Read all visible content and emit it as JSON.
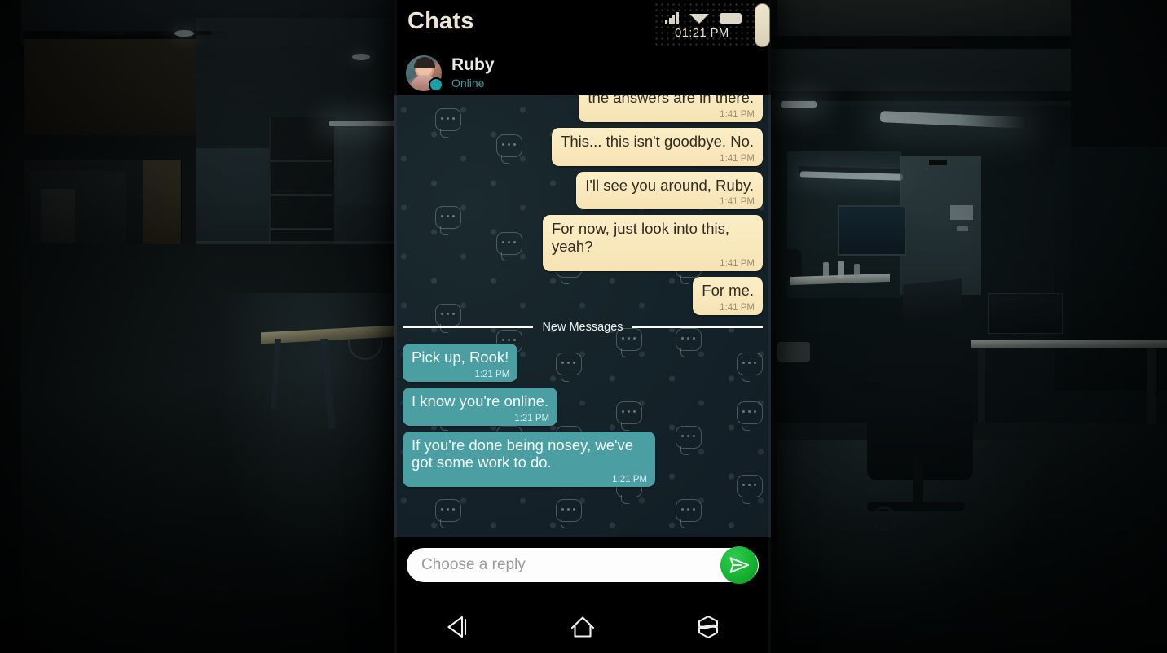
{
  "app": {
    "screen_title": "Chats"
  },
  "status_bar": {
    "time": "01:21 PM",
    "icons": [
      "signal-icon",
      "wifi-icon",
      "battery-icon"
    ]
  },
  "contact": {
    "name": "Ruby",
    "status": "Online",
    "avatar": "contact-avatar"
  },
  "conversation": {
    "divider_label": "New Messages",
    "messages": [
      {
        "id": "m0",
        "side": "right",
        "style": "cream",
        "text": "the answers are in there.",
        "time": "1:41 PM",
        "clipped": true
      },
      {
        "id": "m1",
        "side": "right",
        "style": "cream",
        "text": "This... this isn't goodbye. No.",
        "time": "1:41 PM",
        "clipped": false
      },
      {
        "id": "m2",
        "side": "right",
        "style": "cream",
        "text": "I'll see you around, Ruby.",
        "time": "1:41 PM",
        "clipped": false
      },
      {
        "id": "m3",
        "side": "right",
        "style": "cream",
        "text": "For now, just look into this, yeah?",
        "time": "1:41 PM",
        "clipped": false
      },
      {
        "id": "m4",
        "side": "right",
        "style": "cream",
        "text": "For me.",
        "time": "1:41 PM",
        "clipped": false
      },
      {
        "id": "m5",
        "side": "left",
        "style": "teal",
        "text": "Pick up, Rook!",
        "time": "1:21 PM",
        "clipped": false
      },
      {
        "id": "m6",
        "side": "left",
        "style": "teal",
        "text": "I know you're online.",
        "time": "1:21 PM",
        "clipped": false
      },
      {
        "id": "m7",
        "side": "left",
        "style": "teal",
        "text": "If you're done being nosey, we've got some work to do.",
        "time": "1:21 PM",
        "clipped": false
      }
    ]
  },
  "composer": {
    "placeholder": "Choose a reply",
    "value": "",
    "send_icon": "send-paper-plane-icon"
  },
  "navigation": {
    "back": "back-icon",
    "home": "home-icon",
    "recents": "recents-icon"
  },
  "colors": {
    "cream_bubble": "#F6E3B4",
    "cream_text": "#322A21",
    "teal_bubble": "#4B9EA2",
    "teal_text": "#F3FBFB",
    "online_green": "#17A0A8",
    "send_green": "#14B02F",
    "chat_bg": "#15232A",
    "phone_bg": "#000000"
  }
}
